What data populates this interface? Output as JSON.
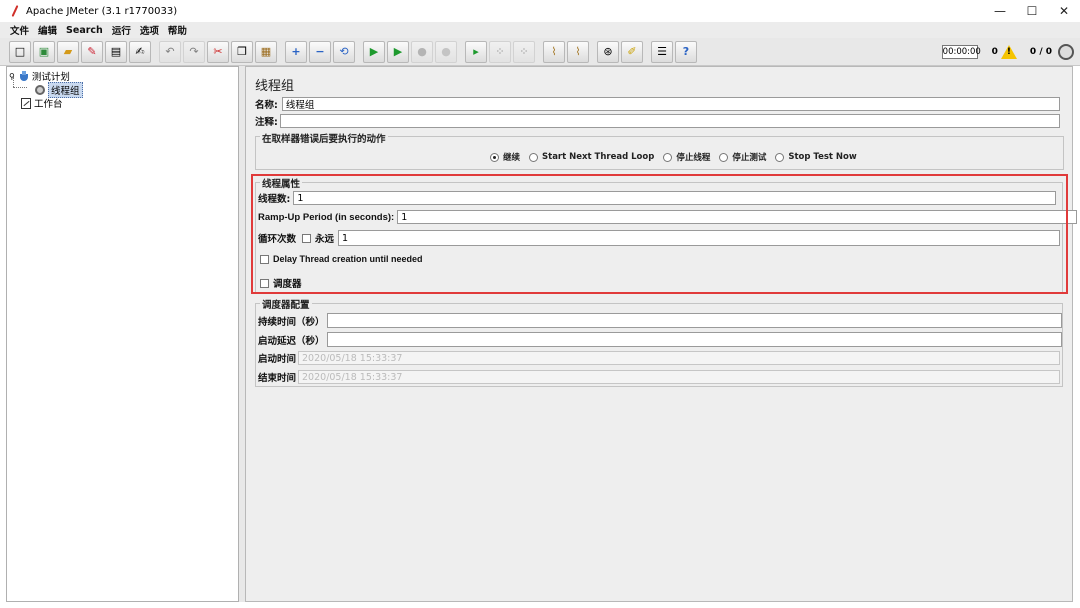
{
  "window": {
    "title": "Apache JMeter (3.1 r1770033)",
    "minimize": "—",
    "maximize": "☐",
    "close": "✕"
  },
  "menu": {
    "items": [
      "文件",
      "编辑",
      "Search",
      "运行",
      "选项",
      "帮助"
    ]
  },
  "toolbar": {
    "buttons": [
      {
        "name": "new-icon",
        "glyph": "□"
      },
      {
        "name": "templates-icon",
        "glyph": "▣"
      },
      {
        "name": "open-icon",
        "glyph": "▰"
      },
      {
        "name": "close-icon",
        "glyph": "✎"
      },
      {
        "name": "save-icon",
        "glyph": "▤"
      },
      {
        "name": "save-as-icon",
        "glyph": "✍"
      },
      {
        "name": "undo-icon",
        "glyph": "↶"
      },
      {
        "name": "redo-icon",
        "glyph": "↷"
      },
      {
        "name": "cut-icon",
        "glyph": "✂"
      },
      {
        "name": "copy-icon",
        "glyph": "❐"
      },
      {
        "name": "paste-icon",
        "glyph": "▦"
      },
      {
        "name": "expand-icon",
        "glyph": "+"
      },
      {
        "name": "collapse-icon",
        "glyph": "−"
      },
      {
        "name": "toggle-icon",
        "glyph": "⟲"
      },
      {
        "name": "start-icon",
        "glyph": "▶"
      },
      {
        "name": "start-no-pause-icon",
        "glyph": "▶"
      },
      {
        "name": "stop-icon",
        "glyph": "●"
      },
      {
        "name": "shutdown-icon",
        "glyph": "●"
      },
      {
        "name": "remote-start-icon",
        "glyph": "▸"
      },
      {
        "name": "remote-stop-icon",
        "glyph": "⁘"
      },
      {
        "name": "remote-shutdown-icon",
        "glyph": "⁘"
      },
      {
        "name": "clear-icon",
        "glyph": "⌇"
      },
      {
        "name": "clear-all-icon",
        "glyph": "⌇"
      },
      {
        "name": "search-icon",
        "glyph": "⊛"
      },
      {
        "name": "reset-search-icon",
        "glyph": "✐"
      },
      {
        "name": "function-helper-icon",
        "glyph": "☰"
      },
      {
        "name": "help-icon",
        "glyph": "?"
      }
    ],
    "timer": "00:00:00",
    "error_count": "0",
    "threads": "0 / 0"
  },
  "tree": {
    "test_plan": "测试计划",
    "thread_group": "线程组",
    "workbench": "工作台"
  },
  "panel": {
    "title": "线程组",
    "name_label": "名称:",
    "name_value": "线程组",
    "comment_label": "注释:",
    "comment_value": "",
    "error_action": {
      "legend": "在取样器错误后要执行的动作",
      "options": [
        {
          "label": "继续",
          "selected": true
        },
        {
          "label": "Start Next Thread Loop",
          "selected": false
        },
        {
          "label": "停止线程",
          "selected": false
        },
        {
          "label": "停止测试",
          "selected": false
        },
        {
          "label": "Stop Test Now",
          "selected": false
        }
      ]
    },
    "thread_props": {
      "legend": "线程属性",
      "threads_label": "线程数:",
      "threads_value": "1",
      "rampup_label": "Ramp-Up Period (in seconds):",
      "rampup_value": "1",
      "loop_label": "循环次数",
      "forever_label": "永远",
      "loop_value": "1",
      "delay_label": "Delay Thread creation until needed",
      "scheduler_label": "调度器"
    },
    "scheduler": {
      "legend": "调度器配置",
      "duration_label": "持续时间（秒）",
      "duration_value": "",
      "delay_label": "启动延迟（秒）",
      "delay_value": "",
      "start_label": "启动时间",
      "start_value": "2020/05/18 15:33:37",
      "end_label": "结束时间",
      "end_value": "2020/05/18 15:33:37"
    }
  }
}
